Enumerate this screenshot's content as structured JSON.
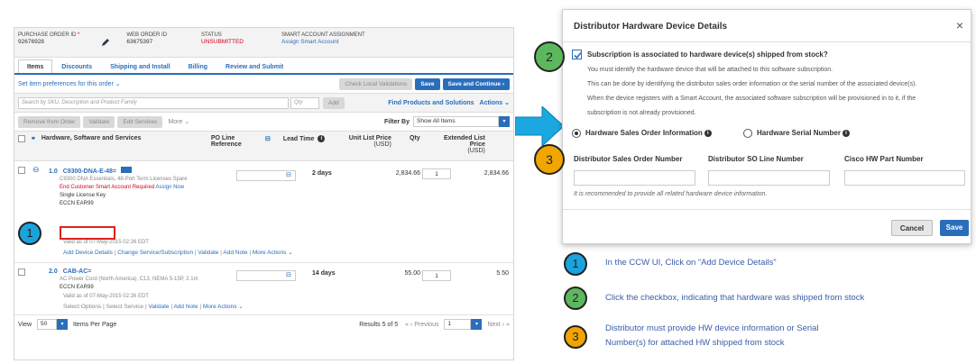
{
  "ccw": {
    "header": {
      "po_label": "PURCHASE ORDER ID",
      "po_value": "92676928",
      "wo_label": "WEB ORDER ID",
      "wo_value": "63675397",
      "status_label": "STATUS",
      "status_value": "UNSUBMITTED",
      "sa_label": "SMART ACCOUNT ASSIGNMENT",
      "sa_value": "Assign Smart Account"
    },
    "tabs": [
      "Items",
      "Discounts",
      "Shipping and Install",
      "Billing",
      "Review and Submit"
    ],
    "pref_link": "Set item preferences for this order",
    "btn_check": "Check Local Validations",
    "btn_save": "Save",
    "btn_save_continue": "Save and Continue",
    "search_placeholder": "Search by SKU, Description and Product Family",
    "qty_placeholder": "Qty",
    "btn_add": "Add",
    "find_link": "Find Products and Solutions",
    "actions_link": "Actions",
    "toolbar": {
      "remove": "Remove from Order",
      "validate": "Validate",
      "edit": "Edit Services",
      "more": "More",
      "filter_label": "Filter By",
      "filter_value": "Show All Items"
    },
    "columns": {
      "hw": "Hardware, Software and Services",
      "po": "PO Line Reference",
      "lead": "Lead Time",
      "unit": "Unit List Price",
      "unit_sub": "(USD)",
      "qty": "Qty",
      "ext": "Extended List Price",
      "ext_sub": "(USD)"
    },
    "row1": {
      "num": "1.0",
      "sku": "C9300-DNA-E-48=",
      "desc1": "C9300 DNA Essentials, 48-Port Term Licenses Spare",
      "warn": "End Customer Smart Account Required",
      "assign": "Assign Now",
      "desc2": "Single License Key",
      "desc3": "ECCN EAR99",
      "valid": "Valid as of 07-May-2015 02:26 EDT",
      "lead": "2 days",
      "price": "2,834.66",
      "qty": "1",
      "ext": "2,834.66",
      "links": [
        "Add Device Details",
        "Change Service/Subscription",
        "Validate",
        "Add Note",
        "More Actions"
      ]
    },
    "row2": {
      "num": "2.0",
      "sku": "CAB-AC=",
      "desc1": "AC Power Cord (North America), C13, NEMA 5-15P, 2.1m",
      "desc2": "ECCN EAR99",
      "valid": "Valid as of 07-May-2015 02:26 EDT",
      "lead": "14 days",
      "price": "55.00",
      "qty": "1",
      "ext": "5.50",
      "links": [
        "Select Options",
        "Select Service",
        "Validate",
        "Add Note",
        "More Actions"
      ]
    },
    "footer": {
      "view_label": "View",
      "view_value": "50",
      "per_page": "Items Per Page",
      "results": "Results 5 of 5",
      "prev": "Previous",
      "page": "1",
      "next": "Next"
    }
  },
  "modal": {
    "title": "Distributor Hardware Device Details",
    "close": "×",
    "question": "Subscription is associated to hardware device(s) shipped from stock?",
    "p1": "You must identify the hardware device that will be attached to this software subscription.",
    "p2": "This can be done by identifying the distributor sales order information or the serial number of the associated device(s).",
    "p3": "When the device registers with a Smart Account, the associated software subscription will be provisioned in to it, if the",
    "p4": "subscription is not already provisioned.",
    "radio1": "Hardware Sales Order Information",
    "radio2": "Hardware Serial Number",
    "field1": "Distributor Sales Order Number",
    "field2": "Distributor SO Line Number",
    "field3": "Cisco HW Part Number",
    "hint": "It is recommended to provide all related hardware device information.",
    "cancel": "Cancel",
    "save": "Save"
  },
  "callouts": {
    "n1": "1",
    "n2": "2",
    "n3": "3",
    "t1": "In the CCW UI, Click on “Add Device Details”",
    "t2": "Click the checkbox, indicating that hardware was shipped from stock",
    "t3a": "Distributor must provide HW device information or Serial",
    "t3b": "Number(s) for attached HW shipped from stock",
    "colors": {
      "c1": "#1aa3dc",
      "c2": "#5cb85c",
      "c3": "#f0a500",
      "arrow": "#1ba8e0"
    }
  }
}
